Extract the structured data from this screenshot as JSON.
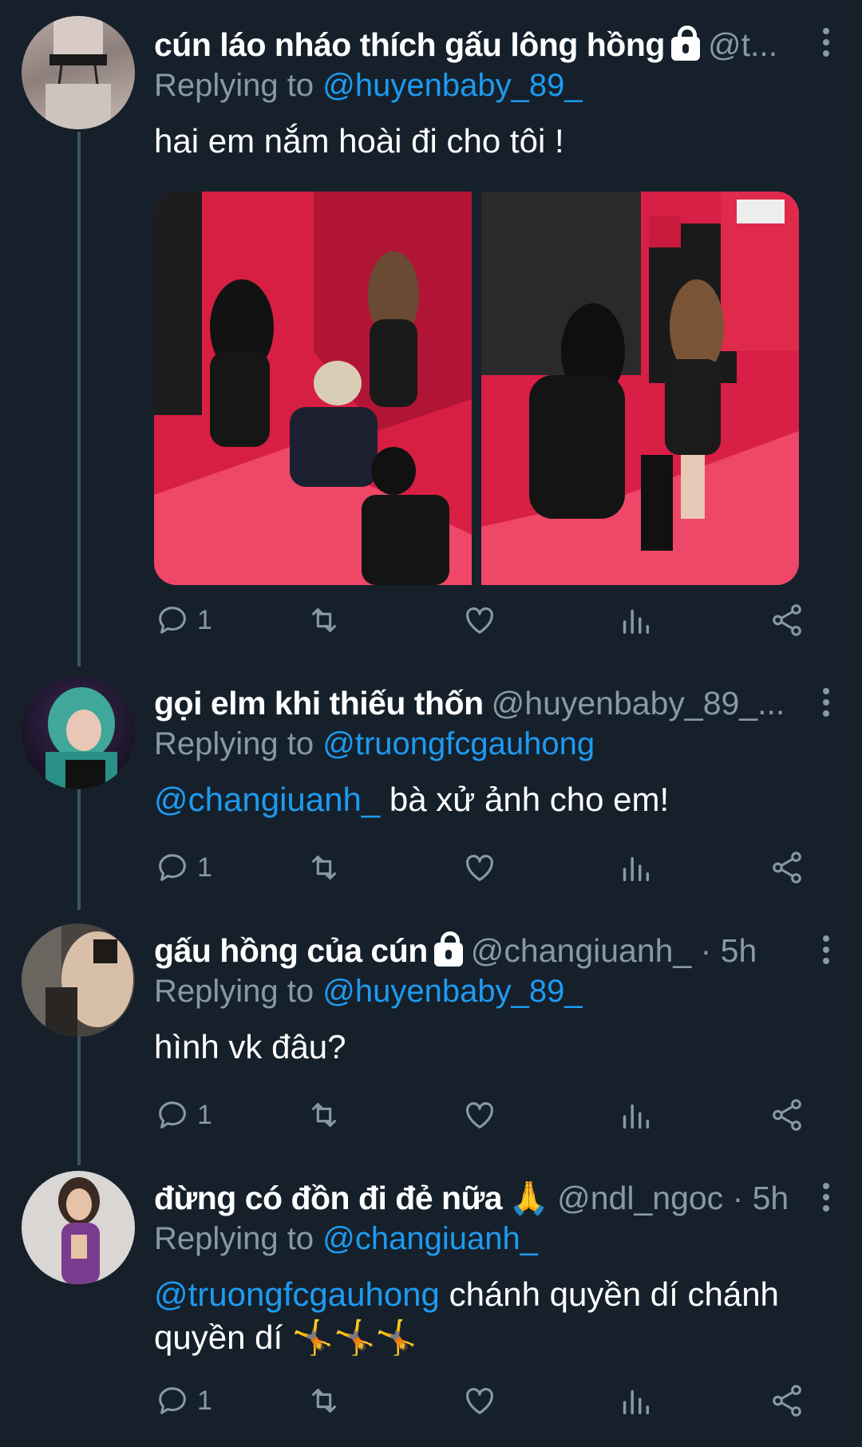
{
  "tweets": [
    {
      "name": "cún láo nháo thích gấu lông hồng",
      "handle": "@t...",
      "replying_label": "Replying to",
      "replying_to": "@huyenbaby_89_",
      "text": "hai em nắm hoài đi cho tôi !",
      "reply_count": "1",
      "locked": true
    },
    {
      "name": "gọi elm khi thiếu thốn",
      "handle": "@huyenbaby_89_...",
      "replying_label": "Replying to",
      "replying_to": "@truongfcgauhong",
      "mention": "@changiuanh_",
      "text": " bà xử ảnh cho em!",
      "reply_count": "1",
      "locked": false
    },
    {
      "name": "gấu hồng của cún",
      "handle": "@changiuanh_ · 5h",
      "replying_label": "Replying to",
      "replying_to": "@huyenbaby_89_",
      "text": "hình vk đâu?",
      "reply_count": "1",
      "locked": true
    },
    {
      "name": "đừng có đồn đi đẻ nữa",
      "name_emoji": "🙏",
      "handle": "@ndl_ngoc · 5h",
      "replying_label": "Replying to",
      "replying_to": "@changiuanh_",
      "mention": "@truongfcgauhong",
      "text": " chánh quyền dí chánh quyền dí",
      "text_emoji": "🤸🤸🤸",
      "reply_count": "1",
      "locked": false
    }
  ],
  "icons": {
    "reply": "reply-icon",
    "retweet": "retweet-icon",
    "like": "heart-icon",
    "analytics": "analytics-icon",
    "share": "share-icon",
    "more": "more-vertical-icon",
    "lock": "lock-icon"
  },
  "colors": {
    "background": "#15202b",
    "link": "#1d9bf0",
    "muted": "#8899a6",
    "thread_line": "#3d5466",
    "media_accent": "#e8264f"
  }
}
